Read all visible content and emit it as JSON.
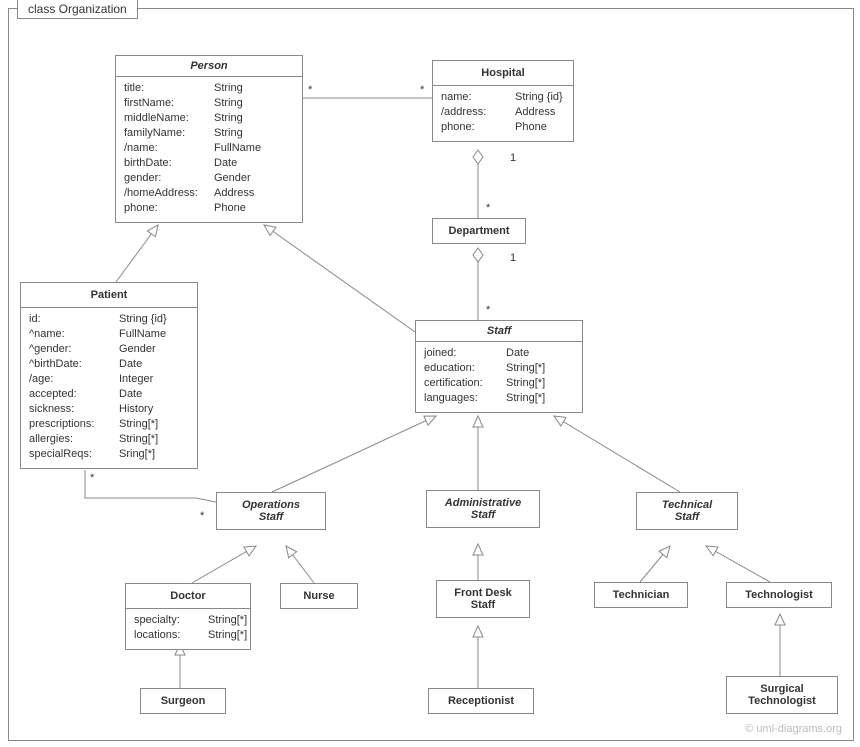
{
  "frame": {
    "title": "class Organization"
  },
  "classes": {
    "person": {
      "name": "Person",
      "attrs": [
        {
          "n": "title:",
          "t": "String"
        },
        {
          "n": "firstName:",
          "t": "String"
        },
        {
          "n": "middleName:",
          "t": "String"
        },
        {
          "n": "familyName:",
          "t": "String"
        },
        {
          "n": "/name:",
          "t": "FullName"
        },
        {
          "n": "birthDate:",
          "t": "Date"
        },
        {
          "n": "gender:",
          "t": "Gender"
        },
        {
          "n": "/homeAddress:",
          "t": "Address"
        },
        {
          "n": "phone:",
          "t": "Phone"
        }
      ]
    },
    "hospital": {
      "name": "Hospital",
      "attrs": [
        {
          "n": "name:",
          "t": "String {id}"
        },
        {
          "n": "/address:",
          "t": "Address"
        },
        {
          "n": "phone:",
          "t": "Phone"
        }
      ]
    },
    "department": {
      "name": "Department"
    },
    "patient": {
      "name": "Patient",
      "attrs": [
        {
          "n": "id:",
          "t": "String {id}"
        },
        {
          "n": "^name:",
          "t": "FullName"
        },
        {
          "n": "^gender:",
          "t": "Gender"
        },
        {
          "n": "^birthDate:",
          "t": "Date"
        },
        {
          "n": "/age:",
          "t": "Integer"
        },
        {
          "n": "accepted:",
          "t": "Date"
        },
        {
          "n": "sickness:",
          "t": "History"
        },
        {
          "n": "prescriptions:",
          "t": "String[*]"
        },
        {
          "n": "allergies:",
          "t": "String[*]"
        },
        {
          "n": "specialReqs:",
          "t": "Sring[*]"
        }
      ]
    },
    "staff": {
      "name": "Staff",
      "attrs": [
        {
          "n": "joined:",
          "t": "Date"
        },
        {
          "n": "education:",
          "t": "String[*]"
        },
        {
          "n": "certification:",
          "t": "String[*]"
        },
        {
          "n": "languages:",
          "t": "String[*]"
        }
      ]
    },
    "opsStaff": {
      "name1": "Operations",
      "name2": "Staff"
    },
    "adminStaff": {
      "name1": "Administrative",
      "name2": "Staff"
    },
    "techStaff": {
      "name1": "Technical",
      "name2": "Staff"
    },
    "doctor": {
      "name": "Doctor",
      "attrs": [
        {
          "n": "specialty:",
          "t": "String[*]"
        },
        {
          "n": "locations:",
          "t": "String[*]"
        }
      ]
    },
    "nurse": {
      "name": "Nurse"
    },
    "frontDesk": {
      "name1": "Front Desk",
      "name2": "Staff"
    },
    "technician": {
      "name": "Technician"
    },
    "technologist": {
      "name": "Technologist"
    },
    "surgeon": {
      "name": "Surgeon"
    },
    "receptionist": {
      "name": "Receptionist"
    },
    "surgTech": {
      "name1": "Surgical",
      "name2": "Technologist"
    }
  },
  "mult": {
    "personHospL": "*",
    "personHospR": "*",
    "hospDeptT": "1",
    "hospDeptB": "*",
    "deptStaffT": "1",
    "deptStaffB": "*",
    "patientOpsL": "*",
    "patientOpsR": "*"
  },
  "watermark": "© uml-diagrams.org"
}
